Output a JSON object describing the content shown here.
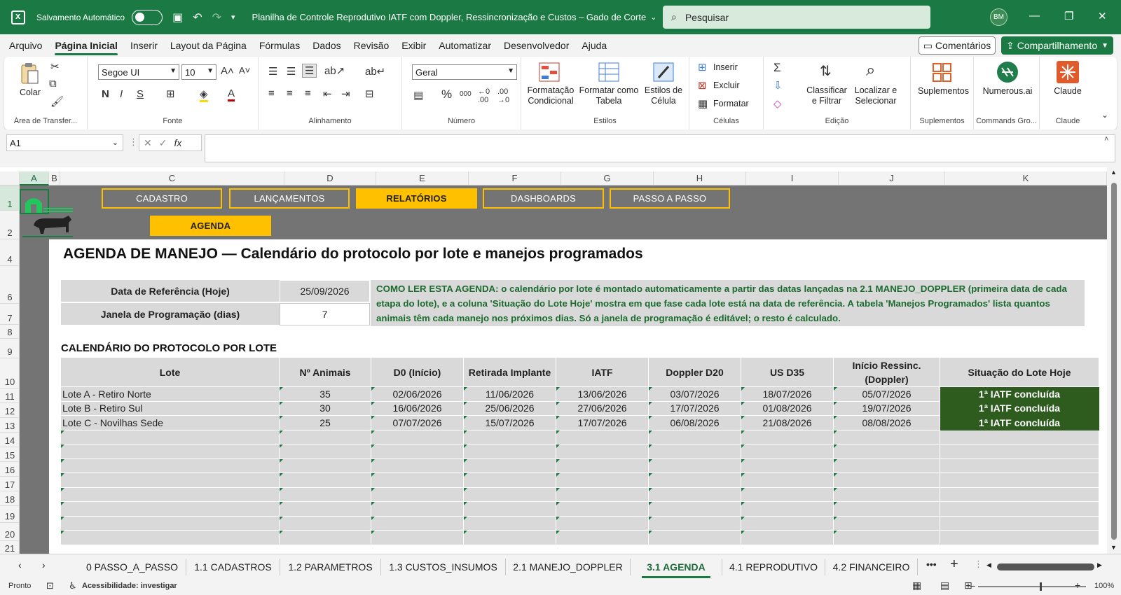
{
  "titlebar": {
    "autosave_label": "Salvamento Automático",
    "doc_title": "Planilha de Controle Reprodutivo IATF com Doppler, Ressincronização e Custos – Gado de Corte",
    "search_placeholder": "Pesquisar",
    "avatar_initials": "BM"
  },
  "menu": {
    "tabs": [
      "Arquivo",
      "Página Inicial",
      "Inserir",
      "Layout da Página",
      "Fórmulas",
      "Dados",
      "Revisão",
      "Exibir",
      "Automatizar",
      "Desenvolvedor",
      "Ajuda"
    ],
    "active_tab": "Página Inicial",
    "comments_label": "Comentários",
    "share_label": "Compartilhamento"
  },
  "ribbon": {
    "clipboard": {
      "paste_label": "Colar",
      "group_label": "Área de Transfer..."
    },
    "font": {
      "family": "Segoe UI",
      "size": "10",
      "bold": "N",
      "italic": "I",
      "underline": "S",
      "group_label": "Fonte"
    },
    "alignment": {
      "group_label": "Alinhamento"
    },
    "number": {
      "format": "Geral",
      "group_label": "Número"
    },
    "styles": {
      "conditional_label": "Formatação Condicional",
      "table_label": "Formatar como Tabela",
      "cell_styles_label": "Estilos de Célula",
      "group_label": "Estilos"
    },
    "cells": {
      "insert_label": "Inserir",
      "delete_label": "Excluir",
      "format_label": "Formatar",
      "group_label": "Células"
    },
    "editing": {
      "sort_label": "Classificar e Filtrar",
      "find_label": "Localizar e Selecionar",
      "group_label": "Edição"
    },
    "addins": {
      "label": "Suplementos",
      "group_label": "Suplementos"
    },
    "numerous": {
      "label": "Numerous.ai",
      "group_label": "Commands Gro..."
    },
    "claude": {
      "label": "Claude",
      "group_label": "Claude"
    }
  },
  "formula_bar": {
    "name_box": "A1",
    "fx": "fx",
    "formula": ""
  },
  "columns": [
    "A",
    "B",
    "C",
    "D",
    "E",
    "F",
    "G",
    "H",
    "I",
    "J",
    "K"
  ],
  "rows": [
    "1",
    "2",
    "4",
    "6",
    "7",
    "8",
    "9",
    "10",
    "11",
    "12",
    "13",
    "14",
    "15",
    "16",
    "17",
    "18",
    "19",
    "20",
    "21"
  ],
  "nav": {
    "buttons": [
      "CADASTRO",
      "LANÇAMENTOS",
      "RELATÓRIOS",
      "DASHBOARDS",
      "PASSO A PASSO"
    ],
    "active": "RELATÓRIOS",
    "sub_button": "AGENDA"
  },
  "sheet": {
    "title": "AGENDA DE MANEJO — Calendário do protocolo por lote e manejos programados",
    "params": [
      {
        "label": "Data de Referência (Hoje)",
        "value": "25/09/2026"
      },
      {
        "label": "Janela de Programação (dias)",
        "value": "7"
      }
    ],
    "howto": "COMO LER ESTA AGENDA: o calendário por lote é montado automaticamente a partir das datas lançadas na 2.1 MANEJO_DOPPLER (primeira data de cada etapa do lote), e a coluna 'Situação do Lote Hoje' mostra em que fase cada lote está na data de referência. A tabela 'Manejos Programados' lista quantos animais têm cada manejo nos próximos dias. Só a janela de programação é editável; o resto é calculado.",
    "section_title": "CALENDÁRIO DO PROTOCOLO POR LOTE",
    "table": {
      "headers": [
        "Lote",
        "Nº Animais",
        "D0 (Início)",
        "Retirada Implante",
        "IATF",
        "Doppler D20",
        "US D35",
        "Início Ressinc. (Doppler)",
        "Situação do Lote Hoje"
      ],
      "rows": [
        [
          "Lote A - Retiro Norte",
          "35",
          "02/06/2026",
          "11/06/2026",
          "13/06/2026",
          "03/07/2026",
          "18/07/2026",
          "05/07/2026",
          "1ª IATF concluída"
        ],
        [
          "Lote B - Retiro Sul",
          "30",
          "16/06/2026",
          "25/06/2026",
          "27/06/2026",
          "17/07/2026",
          "01/08/2026",
          "19/07/2026",
          "1ª IATF concluída"
        ],
        [
          "Lote C - Novilhas Sede",
          "25",
          "07/07/2026",
          "15/07/2026",
          "17/07/2026",
          "06/08/2026",
          "21/08/2026",
          "08/08/2026",
          "1ª IATF concluída"
        ]
      ],
      "empty_rows": 8
    }
  },
  "sheet_tabs": {
    "tabs": [
      "0 PASSO_A_PASSO",
      "1.1 CADASTROS",
      "1.2 PARAMETROS",
      "1.3 CUSTOS_INSUMOS",
      "2.1 MANEJO_DOPPLER",
      "3.1 AGENDA",
      "4.1 REPRODUTIVO",
      "4.2 FINANCEIRO"
    ],
    "active": "3.1 AGENDA"
  },
  "status": {
    "ready": "Pronto",
    "accessibility": "Acessibilidade: investigar",
    "zoom": "100%"
  },
  "colors": {
    "brand": "#1b7a43",
    "nav_gold": "#ffc000",
    "status_green": "#2e5c1e",
    "band_gray": "#747474"
  }
}
